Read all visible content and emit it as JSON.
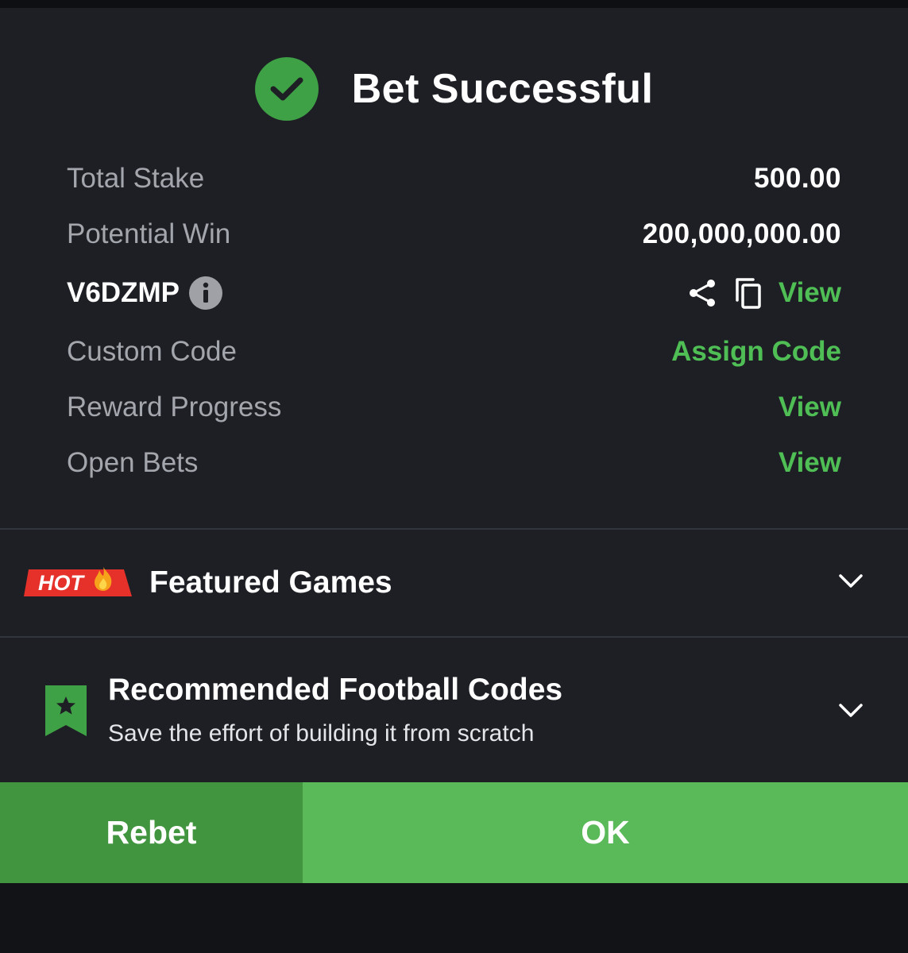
{
  "header": {
    "title": "Bet Successful",
    "icon": "check-circle-icon"
  },
  "details": {
    "total_stake_label": "Total Stake",
    "total_stake_value": "500.00",
    "potential_win_label": "Potential Win",
    "potential_win_value": "200,000,000.00",
    "booking_code": "V6DZMP",
    "booking_view": "View",
    "custom_code_label": "Custom Code",
    "custom_code_action": "Assign Code",
    "reward_progress_label": "Reward Progress",
    "reward_progress_action": "View",
    "open_bets_label": "Open Bets",
    "open_bets_action": "View"
  },
  "featured": {
    "badge": "HOT",
    "title": "Featured Games"
  },
  "recommended": {
    "title": "Recommended Football Codes",
    "subtitle": "Save the effort of building it from scratch"
  },
  "buttons": {
    "rebet": "Rebet",
    "ok": "OK"
  },
  "colors": {
    "accent_green": "#4fbf55",
    "ok_button": "#5ab958",
    "rebet_button": "#41953f",
    "background": "#1e1f25",
    "hot_badge": "#e5312a"
  }
}
